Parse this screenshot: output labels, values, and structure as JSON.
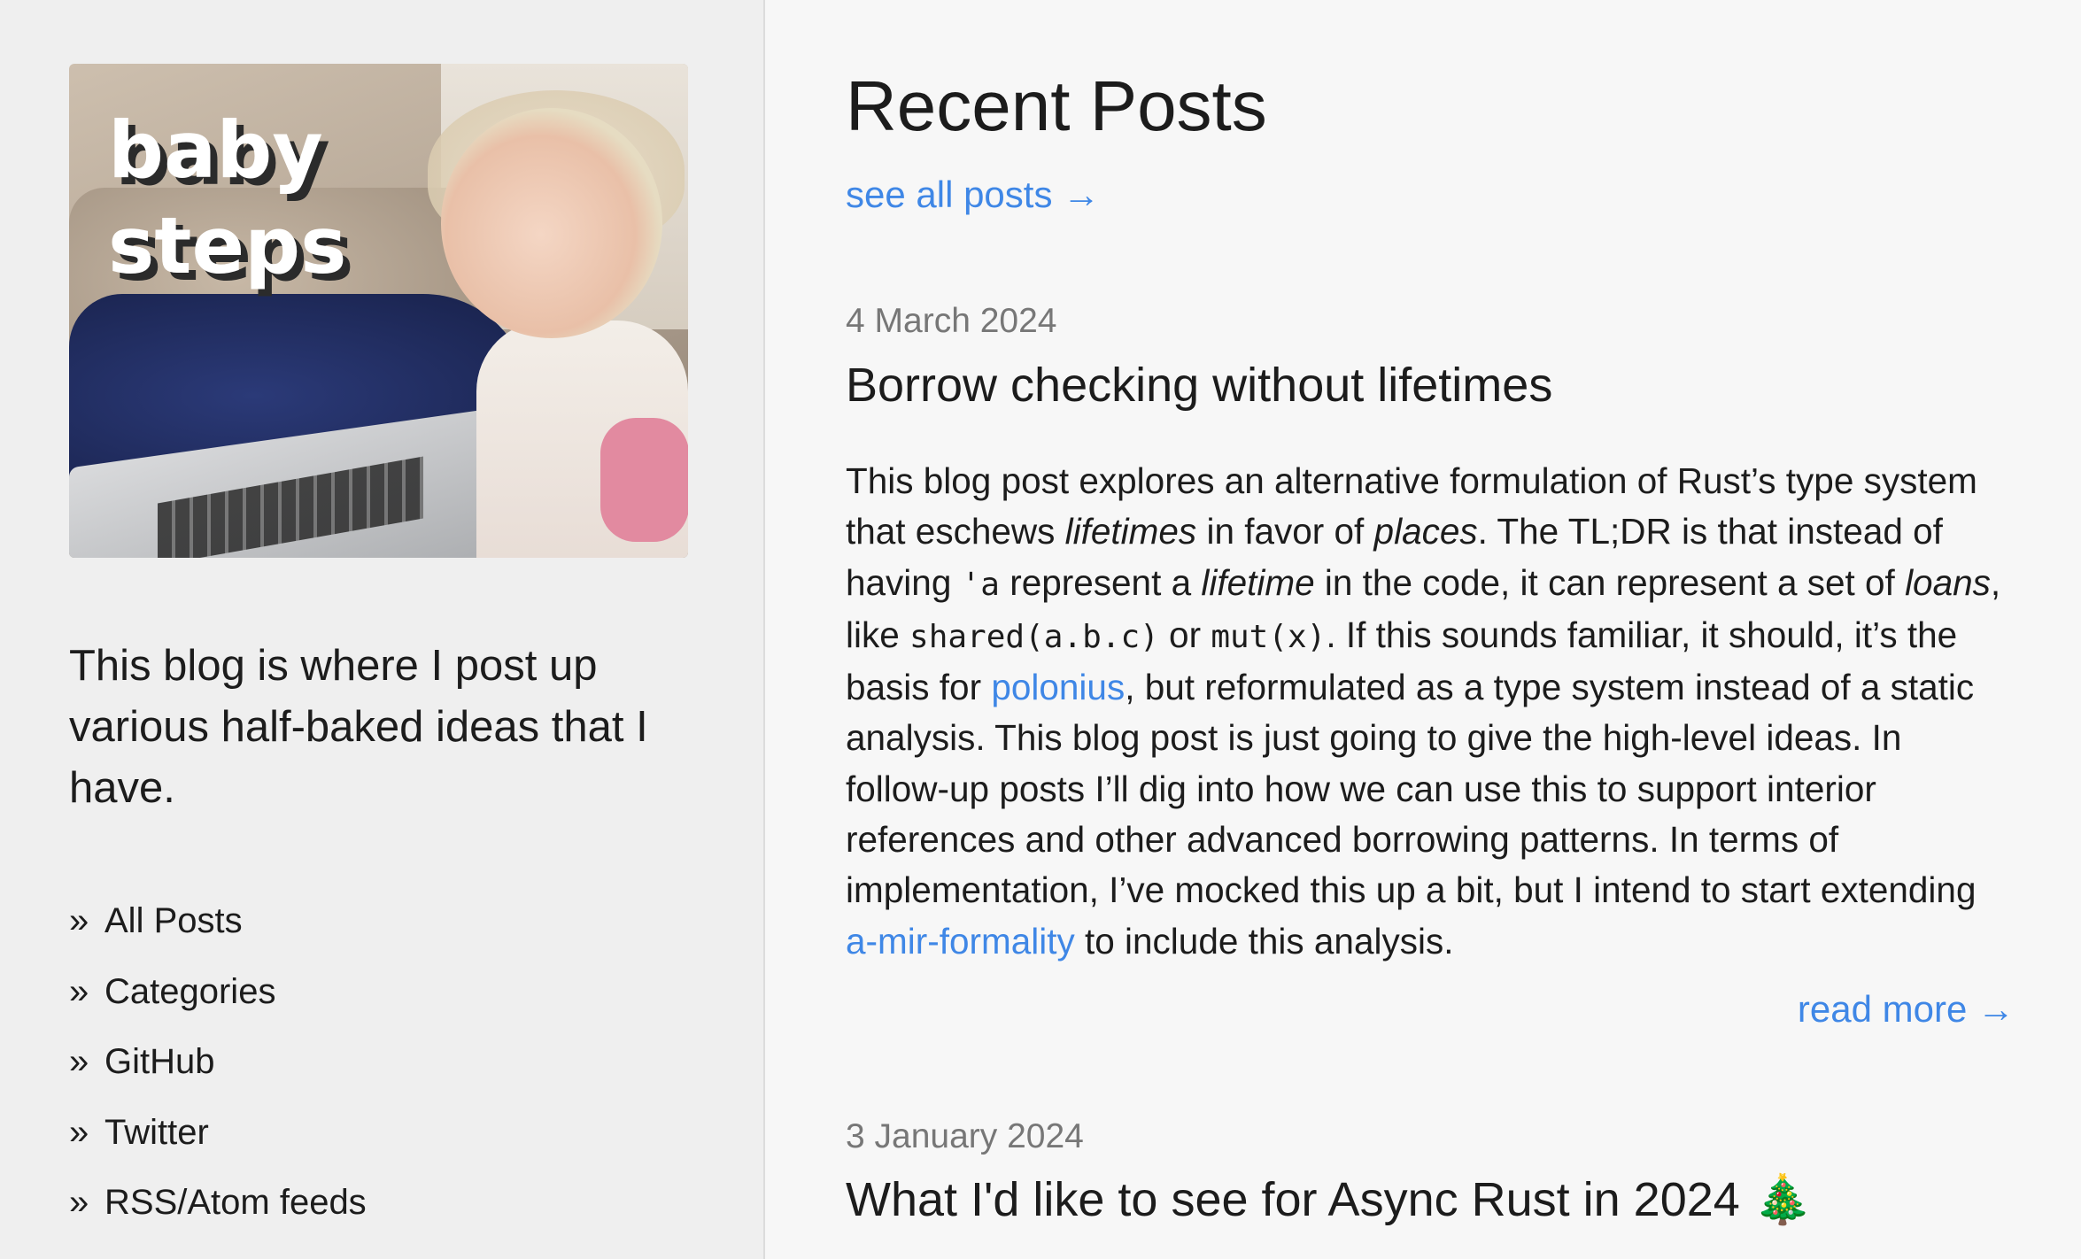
{
  "site": {
    "title_line1": "baby",
    "title_line2": "steps",
    "tagline": "This blog is where I post up various half-baked ideas that I have."
  },
  "nav": {
    "bullet": "»",
    "items": [
      {
        "label": "All Posts"
      },
      {
        "label": "Categories"
      },
      {
        "label": "GitHub"
      },
      {
        "label": "Twitter"
      },
      {
        "label": "RSS/Atom feeds"
      }
    ]
  },
  "main": {
    "heading": "Recent Posts",
    "see_all": "see all posts →",
    "read_more": "read more →"
  },
  "posts": [
    {
      "date": "4 March 2024",
      "title": "Borrow checking without lifetimes",
      "excerpt": {
        "s1": "This blog post explores an alternative formulation of Rust’s type system that eschews ",
        "em1": "lifetimes",
        "s2": " in favor of ",
        "em2": "places",
        "s3": ". The TL;DR is that instead of having ",
        "code1": "'a",
        "s4": " represent a ",
        "em3": "lifetime",
        "s5": " in the code, it can represent a set of ",
        "em4": "loans",
        "s6": ", like ",
        "code2": "shared(a.b.c)",
        "s7": " or ",
        "code3": "mut(x)",
        "s8": ". If this sounds familiar, it should, it’s the basis for ",
        "link1": "polonius",
        "s9": ", but reformulated as a type system instead of a static analysis. This blog post is just going to give the high-level ideas. In follow-up posts I’ll dig into how we can use this to support interior references and other advanced borrowing patterns. In terms of implementation, I’ve mocked this up a bit, but I intend to start extending ",
        "link2": "a-mir-formality",
        "s10": " to include this analysis."
      }
    },
    {
      "date": "3 January 2024",
      "title": "What I'd like to see for Async Rust in 2024 ",
      "emoji": "🎄"
    }
  ],
  "colors": {
    "link": "#3f87e6",
    "sidebar_bg": "#efefef",
    "main_bg": "#f7f7f7",
    "date": "#777777"
  }
}
